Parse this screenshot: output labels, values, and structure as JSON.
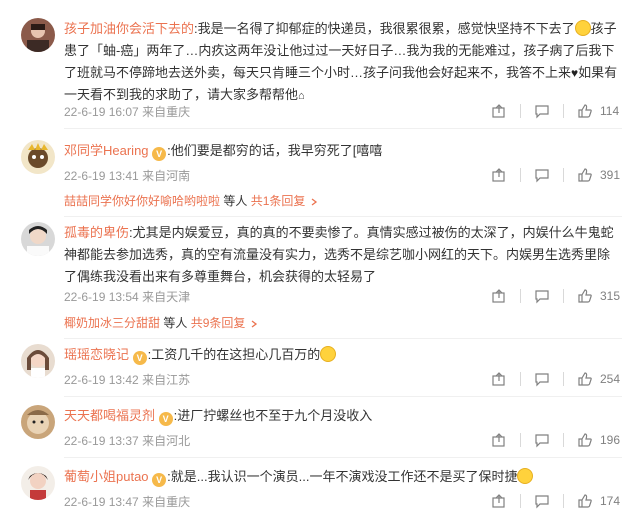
{
  "comments": [
    {
      "username": "孩子加油你会活下去的",
      "text_parts": [
        "我是一名得了抑郁症的快递员，我很累很累，感觉快坚持不下去了",
        "孩子患了「蚰-癌」两年了…内疚这两年没让他过过一天好日子…我为我的无能难过，孩子病了后我下了班就马不停蹄地去送外卖，每天只肯睡三个小时…孩子问我他会好起来不，我答不上来",
        "如果有一天看不到我的求助了，请大家多帮帮他",
        ""
      ],
      "time": "22-6-19 16:07",
      "location": "来自重庆",
      "likes": "114"
    },
    {
      "username": "邓同学Hearing",
      "text": "他们要是都穷的话，我早穷死了[嘻嘻",
      "time": "22-6-19 13:41",
      "location": "来自河南",
      "likes": "391",
      "reply_user": "喆喆同学你好你好喻哈哟啦啦",
      "reply_suffix": "等人",
      "reply_count": "共1条回复"
    },
    {
      "username": "孤毒的卑伤",
      "text": "尤其是内娱爱豆，真的真的不要卖惨了。真情实感过被伤的太深了，内娱什么牛鬼蛇神都能去参加选秀，真的空有流量没有实力，选秀不是综艺咖小网红的天下。内娱男生选秀里除了偶练我没看出来有多尊重舞台，机会获得的太轻易了",
      "time": "22-6-19 13:54",
      "location": "来自天津",
      "likes": "315",
      "reply_user": "椰奶加冰三分甜甜",
      "reply_suffix": "等人",
      "reply_count": "共9条回复"
    },
    {
      "username": "瑶瑶恋晓记",
      "text": "工资几千的在这担心几百万的",
      "time": "22-6-19 13:42",
      "location": "来自江苏",
      "likes": "254"
    },
    {
      "username": "天天都喝福灵剂",
      "text": "进厂拧螺丝也不至于九个月没收入",
      "time": "22-6-19 13:37",
      "location": "来自河北",
      "likes": "196"
    },
    {
      "username": "葡萄小姐putao",
      "text": "就是...我认识一个演员...一年不演戏没工作还不是买了保时捷",
      "time": "22-6-19 13:47",
      "location": "来自重庆",
      "likes": "174"
    }
  ],
  "colors": {
    "username": "#eb7350",
    "meta": "#999999",
    "text": "#333333"
  },
  "icons": [
    "share-icon",
    "comment-icon",
    "like-icon",
    "vip-badge-icon",
    "reply-arrow-icon"
  ]
}
